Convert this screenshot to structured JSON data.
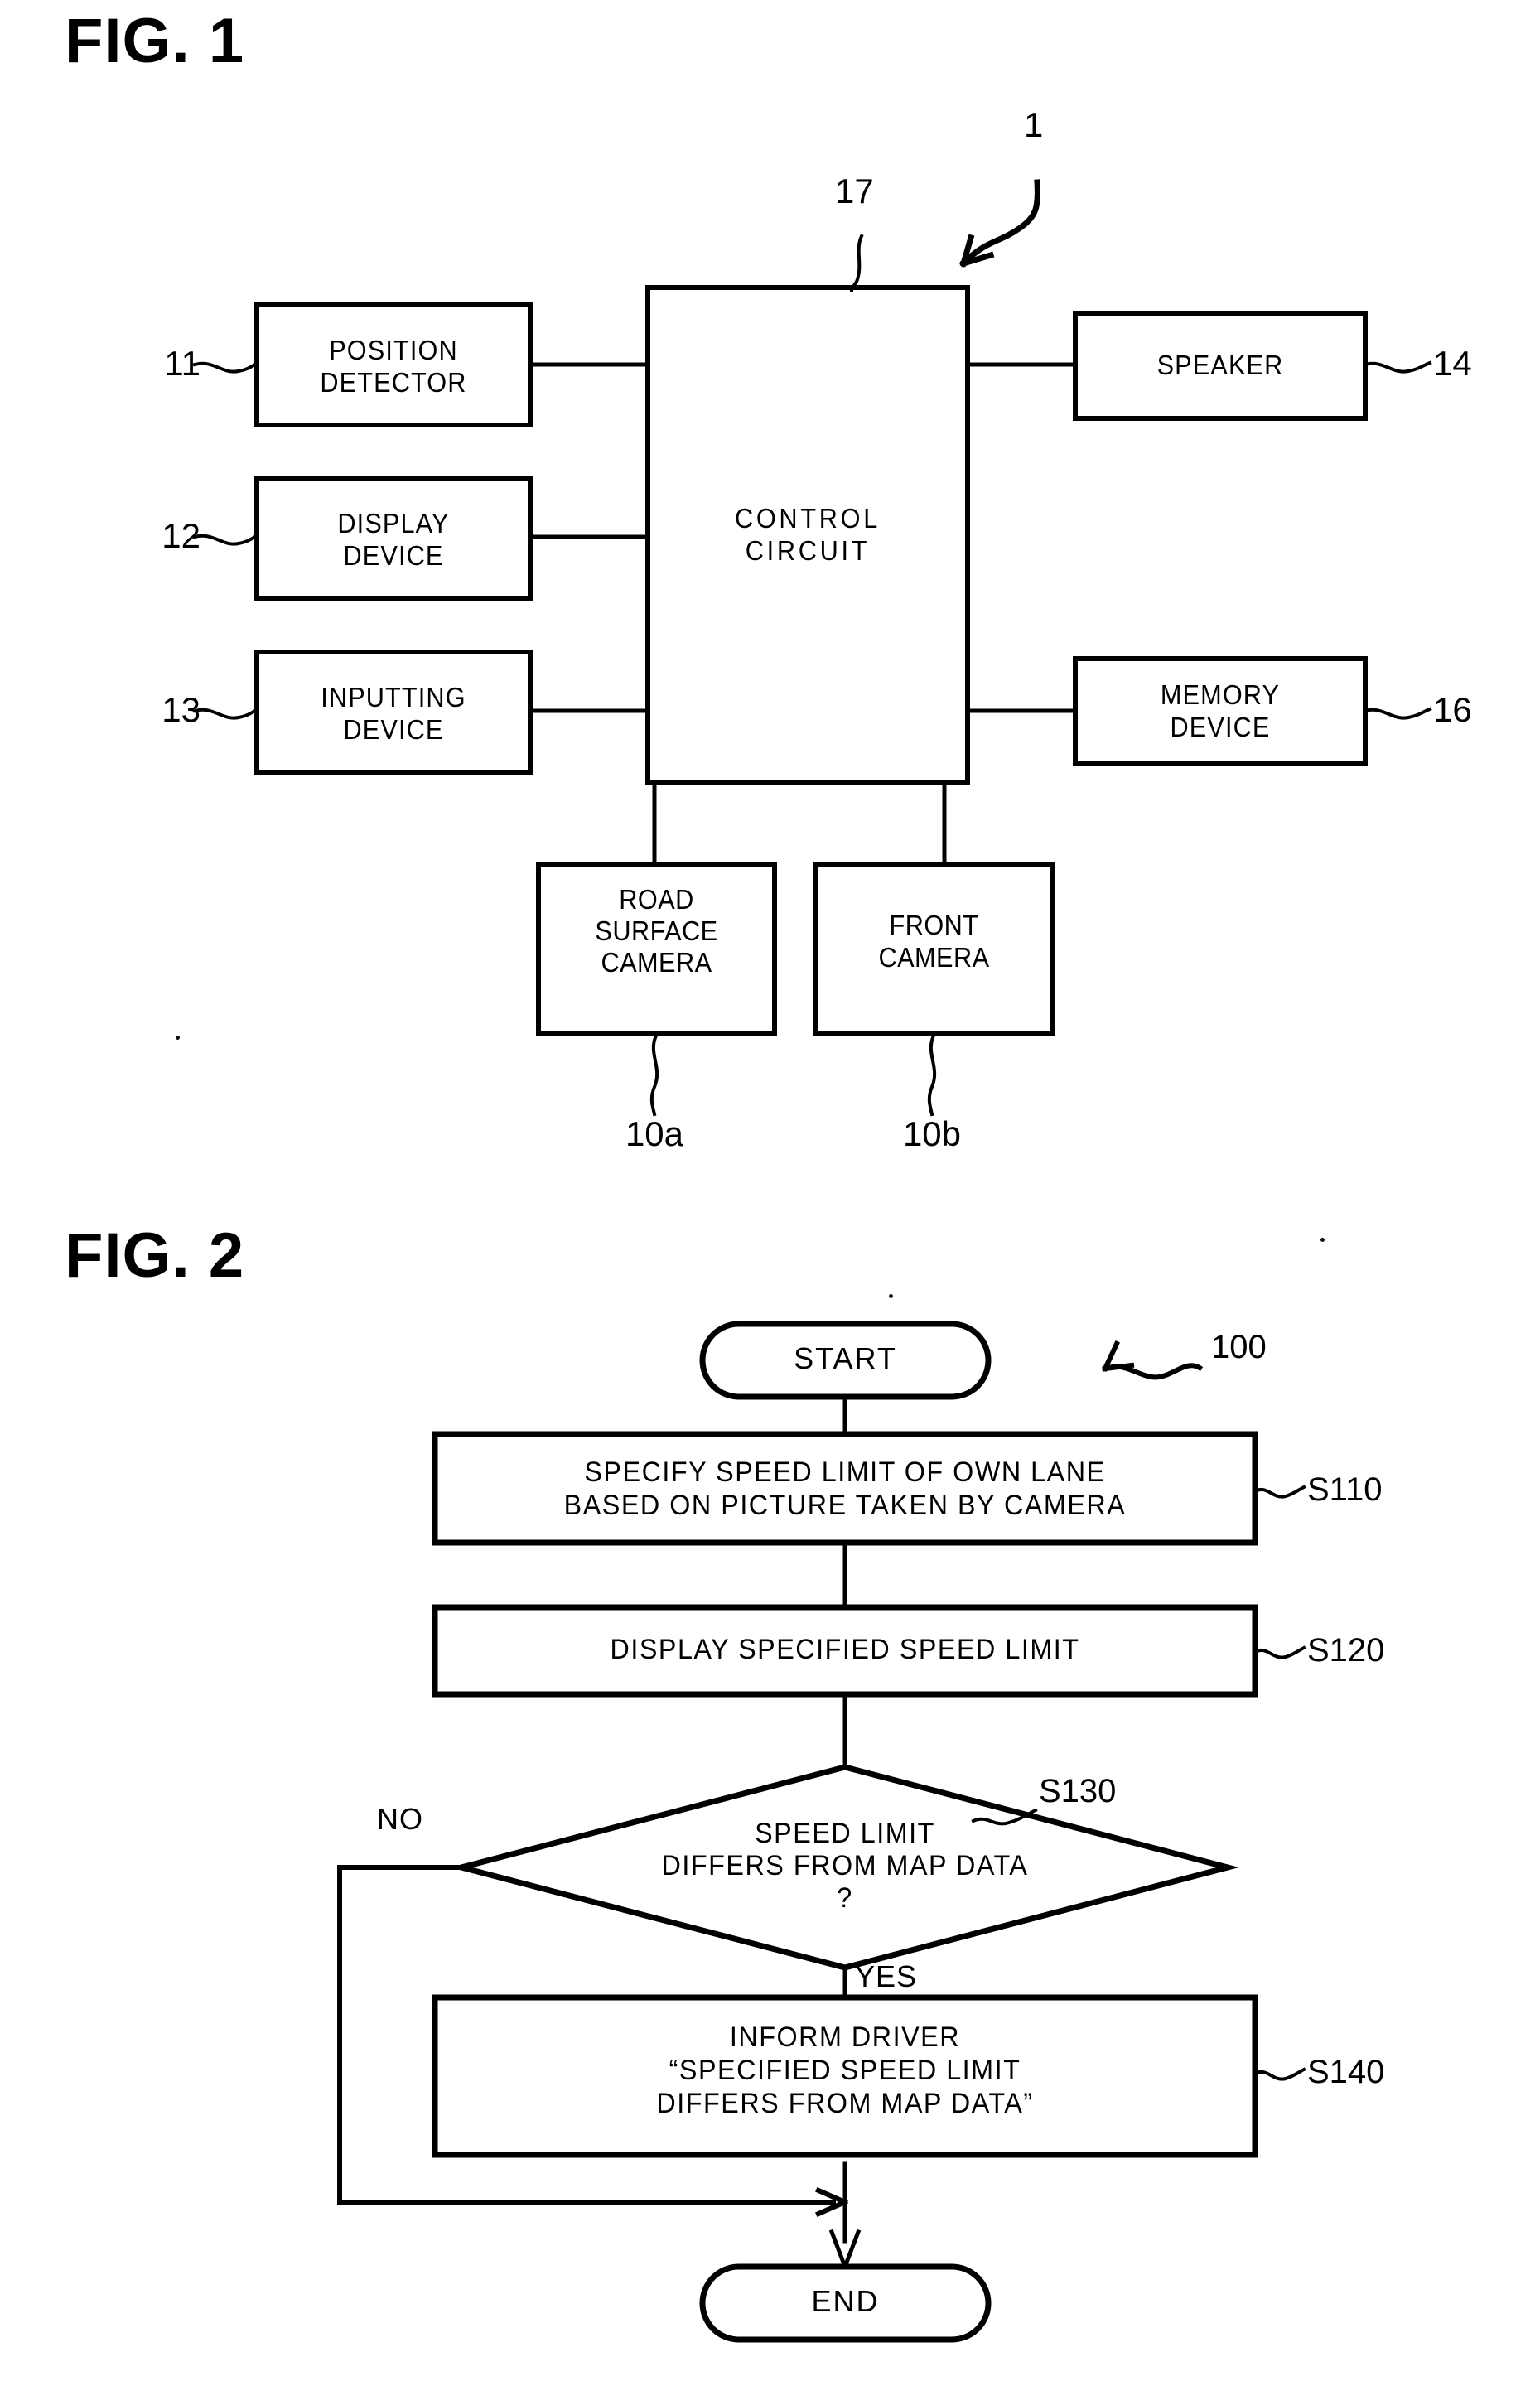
{
  "figure1": {
    "caption": "FIG. 1",
    "system_ref": "1",
    "control_ref": "17",
    "boxes": [
      {
        "id": "position-detector",
        "lines": [
          "POSITION",
          "DETECTOR"
        ],
        "ref": "11"
      },
      {
        "id": "display-device",
        "lines": [
          "DISPLAY",
          "DEVICE"
        ],
        "ref": "12"
      },
      {
        "id": "inputting-device",
        "lines": [
          "INPUTTING",
          "DEVICE"
        ],
        "ref": "13"
      },
      {
        "id": "control-circuit",
        "lines": [
          "CONTROL",
          "CIRCUIT"
        ],
        "ref": "17"
      },
      {
        "id": "speaker",
        "lines": [
          "SPEAKER"
        ],
        "ref": "14"
      },
      {
        "id": "memory-device",
        "lines": [
          "MEMORY",
          "DEVICE"
        ],
        "ref": "16"
      },
      {
        "id": "road-surface-camera",
        "lines": [
          "ROAD",
          "SURFACE",
          "CAMERA"
        ],
        "ref": "10a"
      },
      {
        "id": "front-camera",
        "lines": [
          "FRONT",
          "CAMERA"
        ],
        "ref": "10b"
      }
    ]
  },
  "figure2": {
    "caption": "FIG. 2",
    "process_ref": "100",
    "nodes": [
      {
        "id": "start",
        "type": "terminator",
        "lines": [
          "START"
        ],
        "ref": ""
      },
      {
        "id": "s110",
        "type": "process",
        "lines": [
          "SPECIFY SPEED LIMIT OF OWN LANE",
          "BASED ON PICTURE TAKEN BY CAMERA"
        ],
        "ref": "S110"
      },
      {
        "id": "s120",
        "type": "process",
        "lines": [
          "DISPLAY SPECIFIED SPEED LIMIT"
        ],
        "ref": "S120"
      },
      {
        "id": "s130",
        "type": "decision",
        "lines": [
          "SPEED LIMIT",
          "DIFFERS FROM MAP DATA",
          "?"
        ],
        "ref": "S130"
      },
      {
        "id": "s140",
        "type": "process",
        "lines": [
          "INFORM DRIVER",
          "“SPECIFIED SPEED LIMIT",
          "DIFFERS FROM MAP DATA”"
        ],
        "ref": "S140"
      },
      {
        "id": "end",
        "type": "terminator",
        "lines": [
          "END"
        ],
        "ref": ""
      }
    ],
    "branch_no": "NO",
    "branch_yes": "YES"
  },
  "colors": {
    "ink": "#000000",
    "paper": "#ffffff"
  }
}
